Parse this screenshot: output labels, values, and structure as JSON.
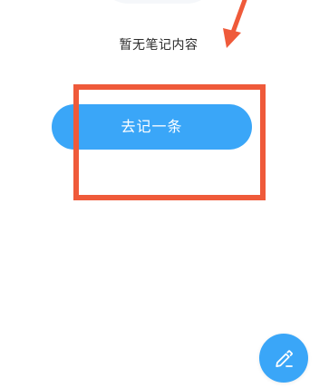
{
  "empty_state": {
    "message": "暂无笔记内容",
    "button_label": "去记一条"
  },
  "fab": {
    "icon": "edit-pen-icon"
  },
  "colors": {
    "accent": "#3aa6f8",
    "annotation": "#ef5a3a",
    "text": "#2b2b2b",
    "background": "#ffffff"
  }
}
